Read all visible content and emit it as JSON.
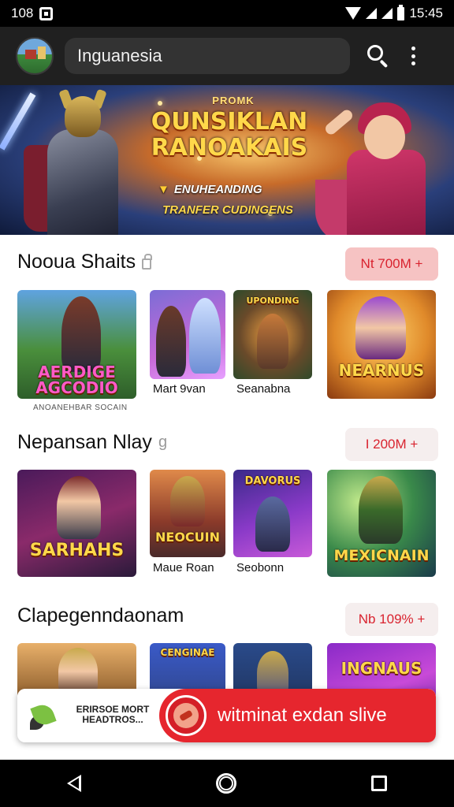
{
  "status_bar": {
    "left_text": "108",
    "time": "15:45"
  },
  "app_bar": {
    "search_value": "Inguanesia"
  },
  "hero": {
    "kicker": "PROMK",
    "title_line1": "QUNSIKLAN",
    "title_line2": "RANOAKAIS",
    "subtitle1": "ENUHEANDING",
    "subtitle2": "TRANFER CUDINGENS"
  },
  "sections": [
    {
      "title": "Nooua Shaits",
      "pill": "Nt 700M +",
      "cards": [
        {
          "logo": "AERDIGE AGCODIO",
          "caption": "",
          "sub": "ANOANEHBAR SOCAIN"
        },
        {
          "logo": "",
          "caption": "Mart 9van"
        },
        {
          "logo": "UPONDING",
          "caption": "Seanabna"
        },
        {
          "logo": "NEARNUS",
          "caption": ""
        }
      ]
    },
    {
      "title": "Nepansan Nlay",
      "pill": "I 200M +",
      "cards": [
        {
          "logo": "SARHAHS",
          "caption": ""
        },
        {
          "logo": "NEOCUIN",
          "caption": "Maue Roan"
        },
        {
          "logo": "DAVORUS",
          "caption": "Seobonn"
        },
        {
          "logo": "MEXICNAIN",
          "caption": ""
        }
      ]
    },
    {
      "title": "Clapegenndaonam",
      "pill": "Nb 109% +",
      "cards": [
        {
          "logo": "",
          "caption": ""
        },
        {
          "logo": "CENGINAE",
          "caption": ""
        },
        {
          "logo": "",
          "caption": ""
        },
        {
          "logo": "INGNAUS",
          "caption": ""
        }
      ]
    }
  ],
  "ad_bar": {
    "left_text": "ERIRSOE MORT HEADTROS...",
    "cta_label": "witminat exdan slive"
  },
  "colors": {
    "accent_red": "#e6262e",
    "pill_text": "#d9232f",
    "app_bar_bg": "#202020"
  },
  "icons": [
    "photo-icon",
    "wifi-icon",
    "signal-icon",
    "battery-icon",
    "search-icon",
    "more-vert-icon",
    "back-icon",
    "home-icon",
    "recents-icon"
  ]
}
